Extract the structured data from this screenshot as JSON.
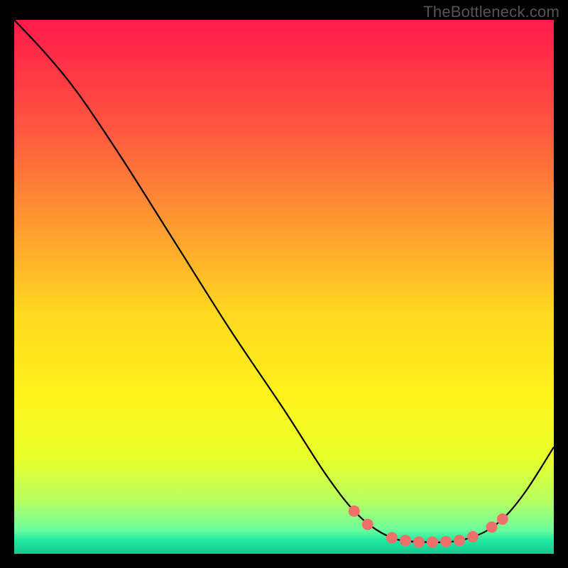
{
  "watermark": "TheBottleneck.com",
  "chart_data": {
    "type": "line",
    "title": "",
    "xlabel": "",
    "ylabel": "",
    "xlim": [
      0,
      100
    ],
    "ylim": [
      0,
      100
    ],
    "background_gradient": {
      "stops": [
        {
          "offset": 0.0,
          "color": "#ff1a4b"
        },
        {
          "offset": 0.2,
          "color": "#ff5540"
        },
        {
          "offset": 0.4,
          "color": "#ffa030"
        },
        {
          "offset": 0.55,
          "color": "#ffd820"
        },
        {
          "offset": 0.7,
          "color": "#fff21a"
        },
        {
          "offset": 0.82,
          "color": "#e8ff2a"
        },
        {
          "offset": 0.9,
          "color": "#b8ff60"
        },
        {
          "offset": 0.955,
          "color": "#6cff9c"
        },
        {
          "offset": 0.975,
          "color": "#20e8a0"
        },
        {
          "offset": 1.0,
          "color": "#18c890"
        }
      ]
    },
    "series": [
      {
        "name": "curve",
        "color": "#000000",
        "points": [
          {
            "x": 0.0,
            "y": 100.0
          },
          {
            "x": 6.0,
            "y": 93.5
          },
          {
            "x": 12.0,
            "y": 86.0
          },
          {
            "x": 20.0,
            "y": 74.0
          },
          {
            "x": 30.0,
            "y": 58.0
          },
          {
            "x": 40.0,
            "y": 42.0
          },
          {
            "x": 50.0,
            "y": 27.0
          },
          {
            "x": 58.0,
            "y": 14.5
          },
          {
            "x": 64.0,
            "y": 7.0
          },
          {
            "x": 70.0,
            "y": 3.0
          },
          {
            "x": 76.0,
            "y": 2.2
          },
          {
            "x": 82.0,
            "y": 2.4
          },
          {
            "x": 87.0,
            "y": 4.0
          },
          {
            "x": 91.0,
            "y": 7.0
          },
          {
            "x": 95.0,
            "y": 12.0
          },
          {
            "x": 100.0,
            "y": 20.0
          }
        ]
      }
    ],
    "markers": {
      "color": "#ef6f6a",
      "radius_px": 8,
      "points": [
        {
          "x": 63.0,
          "y": 8.0
        },
        {
          "x": 65.5,
          "y": 5.5
        },
        {
          "x": 70.0,
          "y": 3.0
        },
        {
          "x": 72.5,
          "y": 2.5
        },
        {
          "x": 75.0,
          "y": 2.2
        },
        {
          "x": 77.5,
          "y": 2.2
        },
        {
          "x": 80.0,
          "y": 2.3
        },
        {
          "x": 82.5,
          "y": 2.5
        },
        {
          "x": 85.0,
          "y": 3.2
        },
        {
          "x": 88.5,
          "y": 5.0
        },
        {
          "x": 90.5,
          "y": 6.5
        }
      ]
    }
  }
}
